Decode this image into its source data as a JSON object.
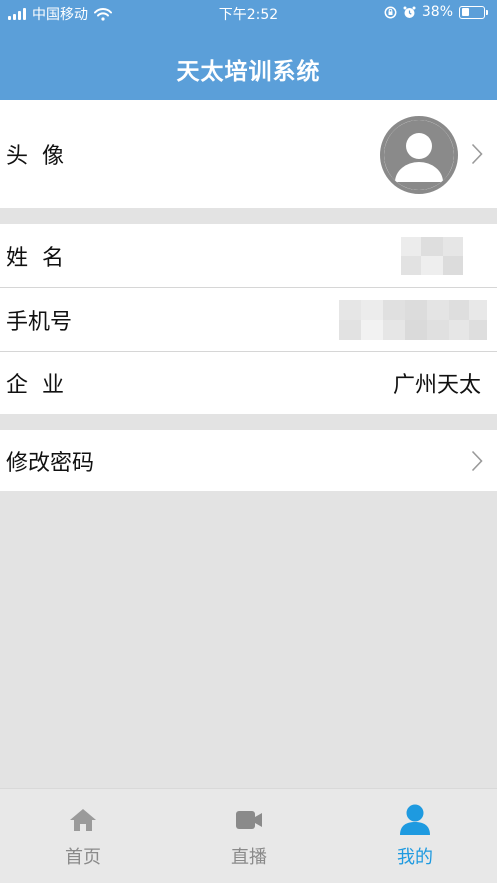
{
  "status_bar": {
    "carrier": "中国移动",
    "time": "下午2:52",
    "battery": "38%",
    "battery_level": 0.38
  },
  "header": {
    "title": "天太培训系统"
  },
  "profile": {
    "avatar_label": "头  像",
    "name_label": "姓  名",
    "phone_label": "手机号",
    "company_label": "企  业",
    "company_value": "广州天太",
    "change_password_label": "修改密码"
  },
  "tabs": [
    {
      "label": "首页",
      "icon": "home-icon"
    },
    {
      "label": "直播",
      "icon": "video-camera-icon"
    },
    {
      "label": "我的",
      "icon": "user-icon"
    }
  ],
  "colors": {
    "header_bg": "#5b9fd9",
    "active_tab": "#1e9ae0",
    "inactive_tab": "#8a8a8a",
    "page_bg": "#e3e3e3"
  }
}
